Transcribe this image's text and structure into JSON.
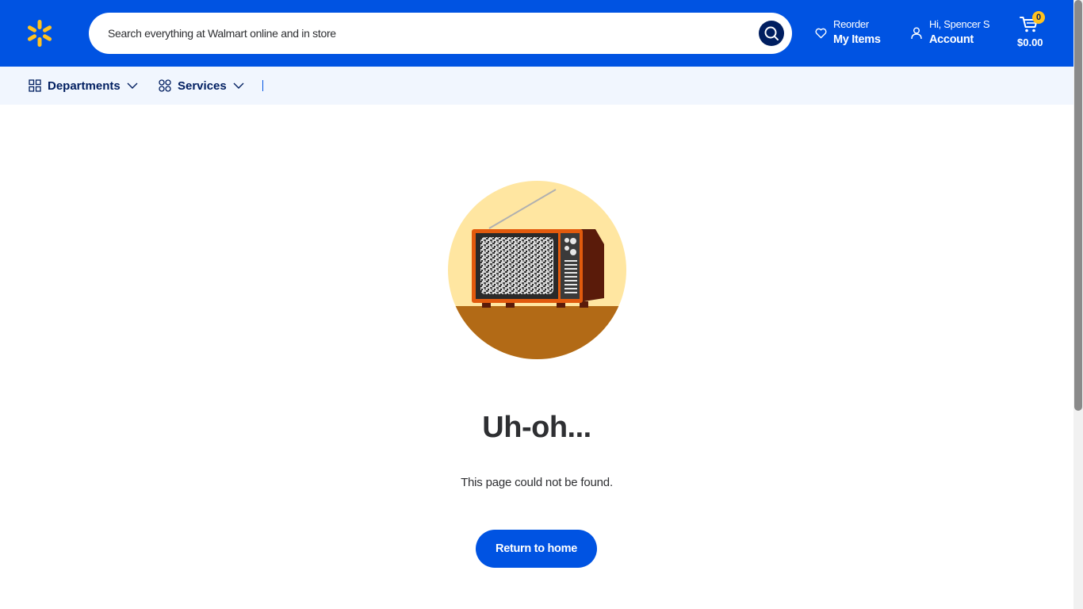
{
  "header": {
    "search_placeholder": "Search everything at Walmart online and in store",
    "reorder_top": "Reorder",
    "reorder_bottom": "My Items",
    "account_top": "Hi, Spencer S",
    "account_bottom": "Account",
    "cart_count": "0",
    "cart_total": "$0.00",
    "icons": [
      "spark-logo-icon",
      "search-icon",
      "heart-icon",
      "user-icon",
      "cart-icon"
    ],
    "colors": {
      "brand_blue": "#0053e2",
      "spark_yellow": "#ffc220",
      "navy": "#001e60"
    }
  },
  "subnav": {
    "departments": "Departments",
    "services": "Services",
    "separator": "|"
  },
  "main": {
    "title": "Uh-oh...",
    "message": "This page could not be found.",
    "home_button": "Return to home",
    "illustration": "retro-tv-static-illustration"
  }
}
